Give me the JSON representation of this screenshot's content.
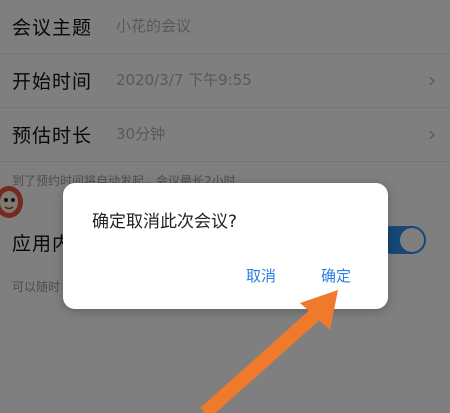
{
  "form": {
    "topic": {
      "label": "会议主题",
      "value": "小花的会议"
    },
    "start_time": {
      "label": "开始时间",
      "value": "2020/3/7 下午9:55"
    },
    "duration": {
      "label": "预估时长",
      "value": "30分钟"
    },
    "hint": "到了预约时间将自动发起，会议最长2小时",
    "app_row": {
      "label": "应用内"
    },
    "bottom_hint": "可以随时"
  },
  "dialog": {
    "message": "确定取消此次会议?",
    "cancel_label": "取消",
    "confirm_label": "确定"
  },
  "colors": {
    "accent": "#2a7fe0",
    "toggle_on": "#2f8ef0",
    "annotation_arrow": "#f07a2c"
  },
  "icons": {
    "row_chevron": "chevron-right-icon",
    "sticker": "cartoon-sticker-icon",
    "annotation": "orange-arrow-icon"
  }
}
